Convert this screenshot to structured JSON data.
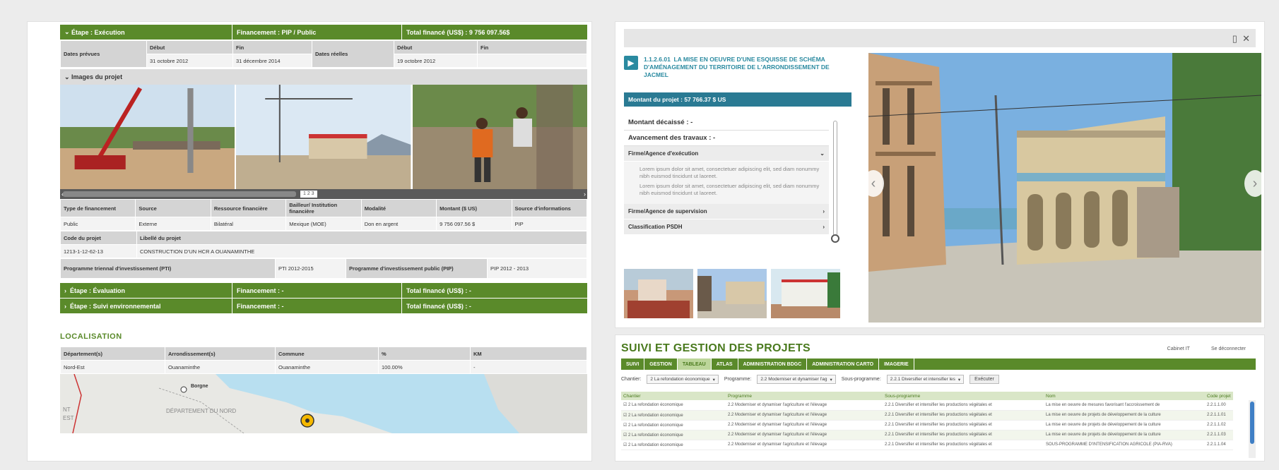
{
  "left": {
    "stage_bar": {
      "etape": "Étape : Exécution",
      "financement": "Financement : PIP / Public",
      "total": "Total financé (US$) : 9 756 097.56$"
    },
    "dates": {
      "prevues_label": "Dates prévues",
      "debut_label": "Début",
      "fin_label": "Fin",
      "prevues_debut": "31 octobre 2012",
      "prevues_fin": "31 décembre 2014",
      "reelles_label": "Dates réelles",
      "reelles_debut": "19 octobre 2012",
      "reelles_fin": ""
    },
    "images_title": "Images du projet",
    "scroll_pages": "1 2 3",
    "fin_table": {
      "headers": [
        "Type de financement",
        "Source",
        "Ressource financière",
        "Bailleur/ Institution financière",
        "Modalité",
        "Montant ($ US)",
        "Source d'informations"
      ],
      "row": [
        "Public",
        "Externe",
        "Bilatéral",
        "Mexique (MOE)",
        "Don en argent",
        "9 756 097.56 $",
        "PIP"
      ]
    },
    "code_label": "Code du projet",
    "libelle_label": "Libellé du projet",
    "code_value": "1213-1-12-62-13",
    "libelle_value": "CONSTRUCTION D'UN HCR A OUANAMINTHE",
    "pti_label": "Programme triennal d'investissement (PTI)",
    "pti_value": "PTI 2012-2015",
    "pip_label": "Programme d'investissement public (PIP)",
    "pip_value": "PIP 2012 - 2013",
    "bars": [
      {
        "etape": "Étape : Évaluation",
        "financement": "Financement : -",
        "total": "Total financé (US$) : -"
      },
      {
        "etape": "Étape : Suivi environnemental",
        "financement": "Financement : -",
        "total": "Total financé (US$) : -"
      }
    ],
    "localisation_title": "LOCALISATION",
    "loc_headers": [
      "Département(s)",
      "Arrondissement(s)",
      "Commune",
      "%",
      "KM"
    ],
    "loc_row": [
      "Nord-Est",
      "Ouanaminthe",
      "Ouanaminthe",
      "100.00%",
      "-"
    ],
    "map_labels": {
      "town": "Borgne",
      "dept": "DÉPARTEMENT DU NORD",
      "nt1": "NT",
      "nt2": "EST"
    }
  },
  "right_top": {
    "project_code": "1.1.2.6.01",
    "project_title": "LA MISE EN OEUVRE D'UNE ESQUISSE DE SCHÉMA D'AMÉNAGEMENT DU TERRITOIRE DE L'ARRONDISSEMENT DE JACMEL",
    "montant": "Montant du projet : 57 766.37 $ US",
    "montant_decaisse": "Montant décaissé : -",
    "avancement": "Avancement des travaux : -",
    "acc_execution": "Firme/Agence d'exécution",
    "lorem1": "Lorem ipsum dolor sit amet, consectetuer adipiscing elit, sed diam nonummy nibh euismod tincidunt ut laoreet.",
    "lorem2": "Lorem ipsum dolor sit amet, consectetuer adipiscing elit, sed diam nonummy nibh euismod tincidunt ut laoreet.",
    "acc_supervision": "Firme/Agence de supervision",
    "acc_psdh": "Classification PSDH"
  },
  "right_bottom": {
    "title": "SUIVI ET GESTION DES PROJETS",
    "links": [
      "Cabinet IT",
      "Se déconnecter"
    ],
    "tabs": [
      "SUIVI",
      "GESTION",
      "TABLEAU",
      "ATLAS",
      "ADMINISTRATION BDGC",
      "ADMINISTRATION CARTO",
      "IMAGERIE"
    ],
    "active_tab": 2,
    "filters": {
      "chantier_label": "Chantier:",
      "chantier_value": "2 La refondation économique",
      "programme_label": "Programme:",
      "programme_value": "2.2 Moderniser et dynamiser l'ag",
      "sousprog_label": "Sous-programme:",
      "sousprog_value": "2.2.1 Diversifier et intensifier les",
      "button": "Exécuter"
    },
    "table_headers": [
      "Chantier",
      "Programme",
      "Sous-programme",
      "Nom",
      "Code projet"
    ],
    "rows": [
      [
        "2 La refondation économique",
        "2.2 Moderniser et dynamiser l'agriculture et l'élevage",
        "2.2.1 Diversifier et intensifier les productions végétales et",
        "La mise en oeuvre de mesures favorisant l'accroissement de",
        "2.2.1.1.00"
      ],
      [
        "2 La refondation économique",
        "2.2 Moderniser et dynamiser l'agriculture et l'élevage",
        "2.2.1 Diversifier et intensifier les productions végétales et",
        "La mise en oeuvre de projets de développement de la culture",
        "2.2.1.1.01"
      ],
      [
        "2 La refondation économique",
        "2.2 Moderniser et dynamiser l'agriculture et l'élevage",
        "2.2.1 Diversifier et intensifier les productions végétales et",
        "La mise en oeuvre de projets de développement de la culture",
        "2.2.1.1.02"
      ],
      [
        "2 La refondation économique",
        "2.2 Moderniser et dynamiser l'agriculture et l'élevage",
        "2.2.1 Diversifier et intensifier les productions végétales et",
        "La mise en oeuvre de projets de développement de la culture",
        "2.2.1.1.03"
      ],
      [
        "2 La refondation économique",
        "2.2 Moderniser et dynamiser l'agriculture et l'élevage",
        "2.2.1 Diversifier et intensifier les productions végétales et",
        "SOUS-PROGRAMME D'INTENSIFICATION AGRICOLE (PIA-RVA)",
        "2.2.1.1.04"
      ]
    ]
  }
}
